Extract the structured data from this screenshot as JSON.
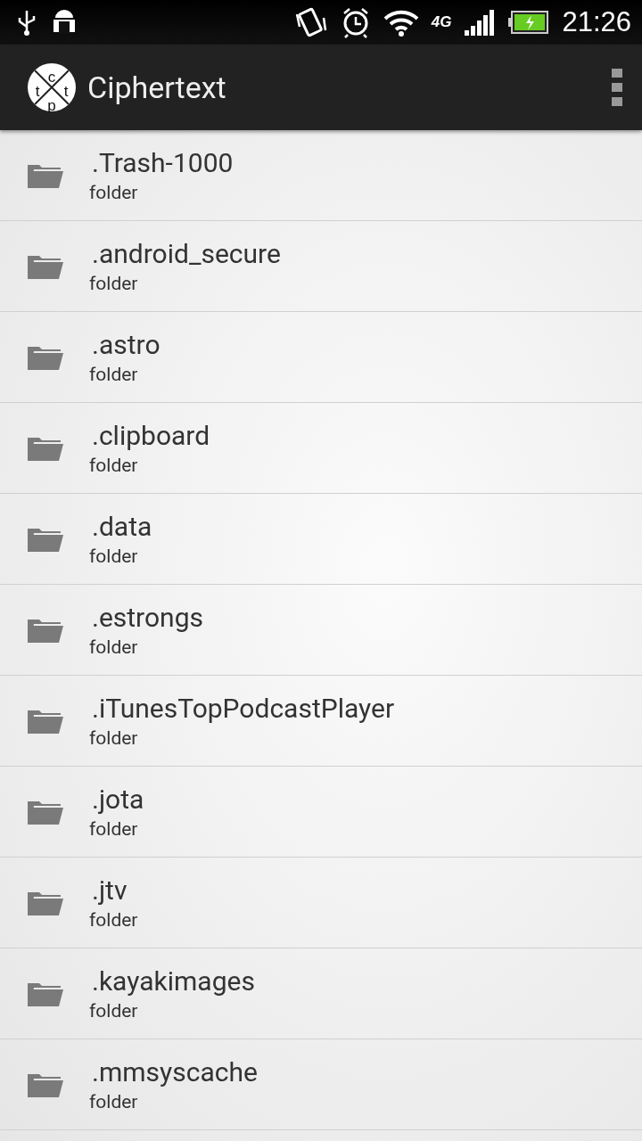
{
  "status_bar": {
    "network": "4G",
    "time": "21:26"
  },
  "app_bar": {
    "logo_letters": [
      "c",
      "t",
      "p",
      "t"
    ],
    "title": "Ciphertext"
  },
  "files": [
    {
      "name": ".Trash-1000",
      "type": "folder"
    },
    {
      "name": ".android_secure",
      "type": "folder"
    },
    {
      "name": ".astro",
      "type": "folder"
    },
    {
      "name": ".clipboard",
      "type": "folder"
    },
    {
      "name": ".data",
      "type": "folder"
    },
    {
      "name": ".estrongs",
      "type": "folder"
    },
    {
      "name": ".iTunesTopPodcastPlayer",
      "type": "folder"
    },
    {
      "name": ".jota",
      "type": "folder"
    },
    {
      "name": ".jtv",
      "type": "folder"
    },
    {
      "name": ".kayakimages",
      "type": "folder"
    },
    {
      "name": ".mmsyscache",
      "type": "folder"
    }
  ]
}
